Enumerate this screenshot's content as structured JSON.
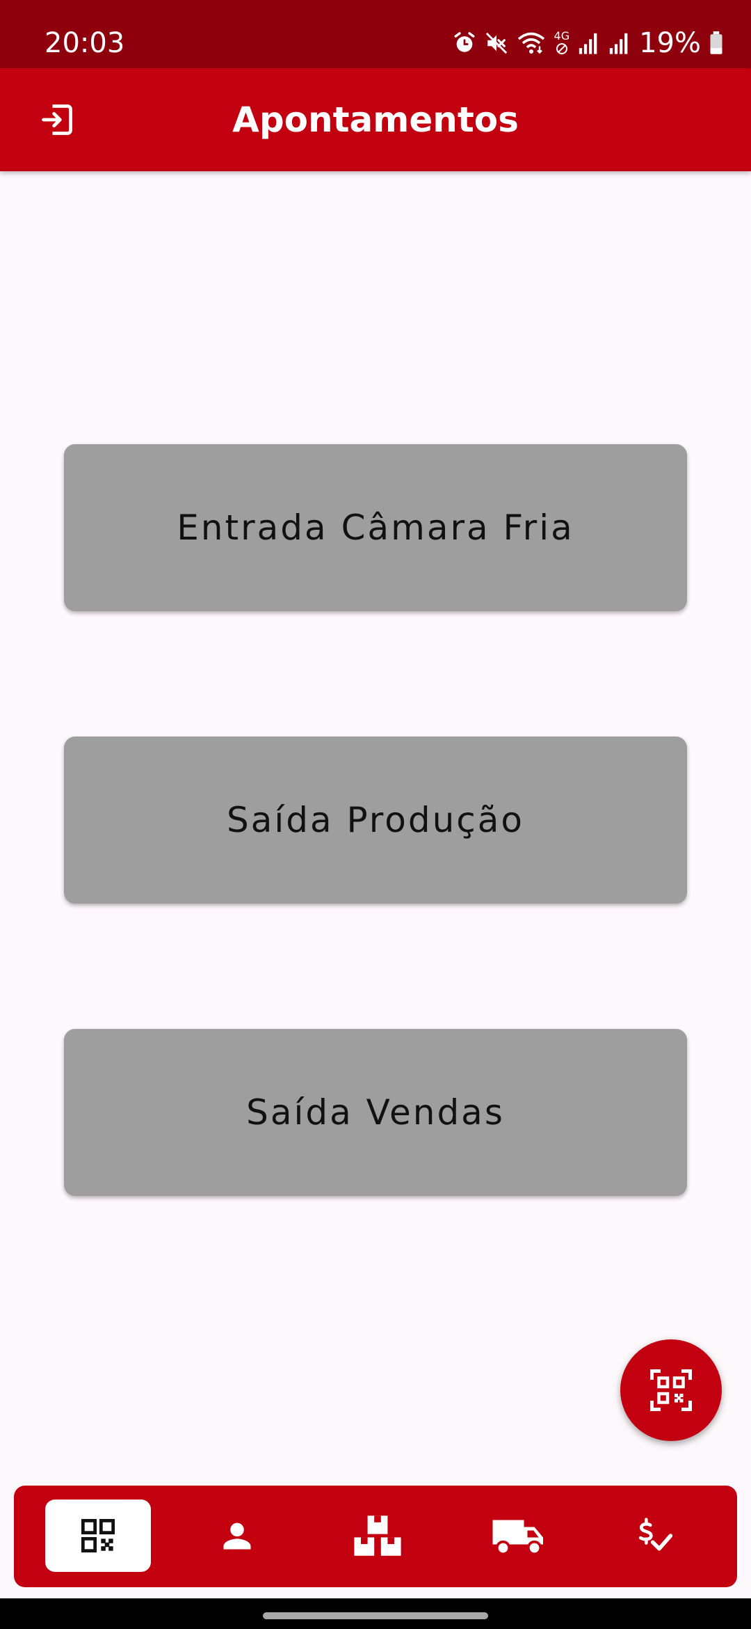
{
  "status_bar": {
    "time": "20:03",
    "battery_percent": "19%",
    "network_label": "4G",
    "icons": [
      "alarm-icon",
      "mute-icon",
      "wifi-icon",
      "network-4g-icon",
      "signal-icon",
      "signal-icon",
      "battery-icon"
    ]
  },
  "app_bar": {
    "title": "Apontamentos",
    "leading_icon": "logout-icon",
    "background": "#c2000f"
  },
  "actions": [
    {
      "label": "Entrada Câmara Fria"
    },
    {
      "label": "Saída Produção"
    },
    {
      "label": "Saída Vendas"
    }
  ],
  "fab": {
    "icon": "qr-scan-icon",
    "color": "#c2000f"
  },
  "bottom_nav": {
    "selected_index": 0,
    "items": [
      {
        "icon": "qr-code-icon"
      },
      {
        "icon": "person-icon"
      },
      {
        "icon": "boxes-icon"
      },
      {
        "icon": "truck-icon"
      },
      {
        "icon": "price-check-icon"
      }
    ]
  },
  "colors": {
    "status_bar": "#8f000d",
    "primary": "#c2000f",
    "button_gray": "#9e9e9e",
    "background": "#fdf8fb"
  }
}
